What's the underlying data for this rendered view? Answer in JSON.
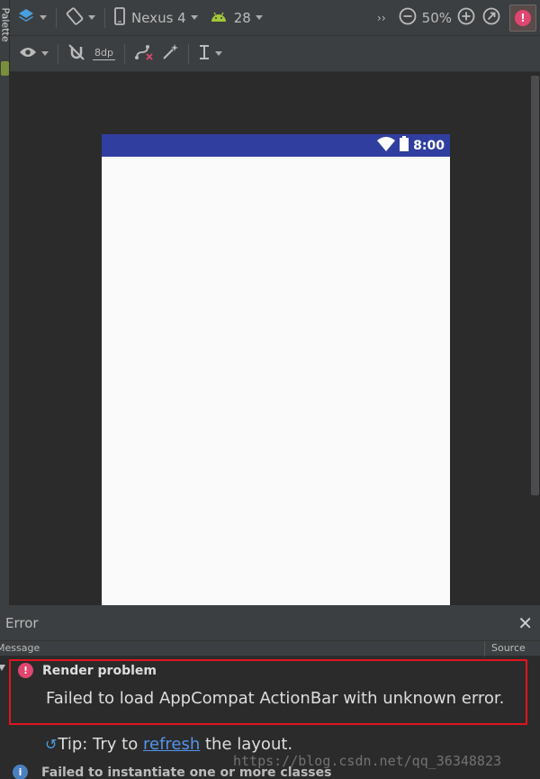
{
  "palette": {
    "label": "Palette"
  },
  "toolbar": {
    "device": "Nexus 4",
    "api": "28",
    "overflow": "››",
    "zoom": "50%",
    "margin": "8dp"
  },
  "device": {
    "status_time": "8:00"
  },
  "error_panel": {
    "title": "Error",
    "columns": {
      "message": "Message",
      "source": "Source"
    },
    "problem": {
      "title": "Render problem",
      "message": "Failed to load AppCompat ActionBar with unknown error."
    },
    "tip": {
      "prefix": "Tip: Try to ",
      "link": "refresh",
      "suffix": " the layout."
    },
    "next_item": "Failed to instantiate one or more classes"
  },
  "watermark": "https://blog.csdn.net/qq_36348823",
  "colors": {
    "accent_status_bar": "#303f9f",
    "error_red": "#e0466f",
    "highlight_box": "#e0141e",
    "link": "#5394ec"
  },
  "icons": {
    "toolbar1": [
      "layers-icon",
      "rotate-icon",
      "phone-icon",
      "android-icon",
      "zoom-out-icon",
      "zoom-in-icon",
      "zoom-fit-icon",
      "error-indicator-icon"
    ],
    "toolbar2": [
      "eye-icon",
      "magnet-off-icon",
      "clear-constraints-icon",
      "magic-wand-icon",
      "align-icon"
    ]
  }
}
